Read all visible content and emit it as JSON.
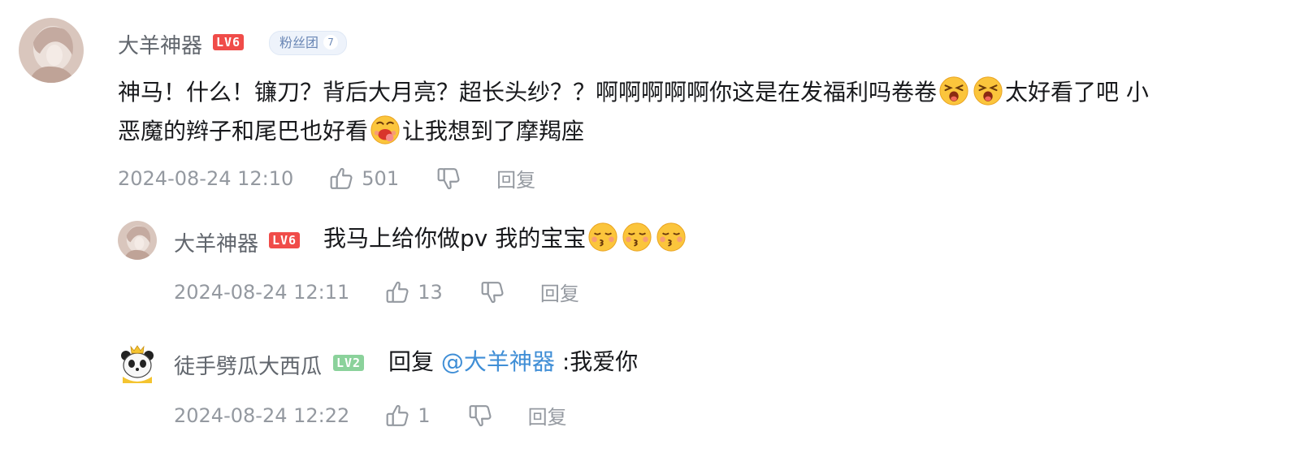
{
  "main_comment": {
    "username": "大羊神器",
    "level": "LV6",
    "fan_badge": {
      "label": "粉丝团",
      "level": "7"
    },
    "text_parts": [
      "神马！什么！镰刀？背后大月亮？超长头纱？？啊啊啊啊啊你这是在发福利吗卷卷",
      "太好看了吧 小",
      "恶魔的辫子和尾巴也好看",
      "让我想到了摩羯座"
    ],
    "emojis": [
      "grinning-squint-emoji",
      "grinning-squint-emoji",
      "drooling-emoji"
    ],
    "time": "2024-08-24 12:10",
    "likes": "501",
    "reply_label": "回复"
  },
  "replies": [
    {
      "username": "大羊神器",
      "level": "LV6",
      "text": "我马上给你做pv 我的宝宝",
      "emojis": [
        "kissing-emoji",
        "kissing-emoji",
        "kissing-emoji"
      ],
      "time": "2024-08-24 12:11",
      "likes": "13",
      "reply_label": "回复"
    },
    {
      "username": "徒手劈瓜大西瓜",
      "level": "LV2",
      "reply_prefix": "回复",
      "mention": "@大羊神器",
      "text": ":我爱你",
      "time": "2024-08-24 12:22",
      "likes": "1",
      "reply_label": "回复"
    }
  ],
  "colors": {
    "username": "#61666d",
    "meta": "#9499a0",
    "mention": "#3f8ed6",
    "lv_red": "#f04c49",
    "lv_green": "#8bd29b"
  }
}
